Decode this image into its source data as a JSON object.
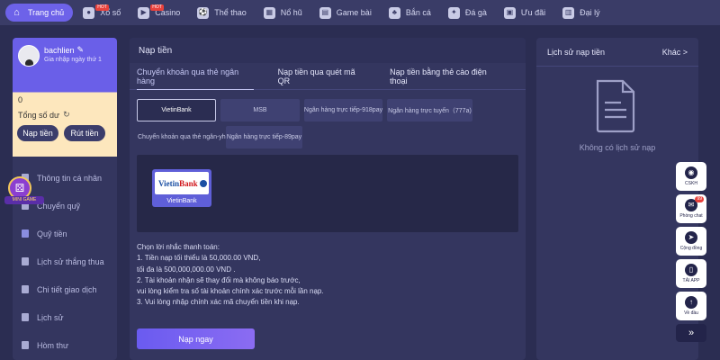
{
  "nav": [
    {
      "label": "Trang chủ",
      "icon": "home-icon",
      "glyph": "⌂",
      "active": true
    },
    {
      "label": "Xổ số",
      "icon": "lottery-icon",
      "glyph": "●",
      "hot": "HOT"
    },
    {
      "label": "Casino",
      "icon": "casino-icon",
      "glyph": "▶",
      "hot": "HOT"
    },
    {
      "label": "Thể thao",
      "icon": "sports-icon",
      "glyph": "⚽"
    },
    {
      "label": "Nổ hũ",
      "icon": "slots-icon",
      "glyph": "▦"
    },
    {
      "label": "Game bài",
      "icon": "card-game-icon",
      "glyph": "▤"
    },
    {
      "label": "Bắn cá",
      "icon": "fish-icon",
      "glyph": "♣"
    },
    {
      "label": "Đá gà",
      "icon": "cockfight-icon",
      "glyph": "✦"
    },
    {
      "label": "Ưu đãi",
      "icon": "promo-icon",
      "glyph": "▣"
    },
    {
      "label": "Đại lý",
      "icon": "agent-icon",
      "glyph": "▥"
    }
  ],
  "profile": {
    "username": "bachlien",
    "level": "Gia nhập ngày thứ 1",
    "balance": "0",
    "balance_label": "Tổng số dư",
    "deposit_label": "Nạp tiền",
    "withdraw_label": "Rút tiền"
  },
  "menu": [
    {
      "label": "Thông tin cá nhân",
      "name": "menu-item-profile"
    },
    {
      "label": "Chuyển quỹ",
      "name": "menu-item-transfer"
    },
    {
      "label": "Quỹ tiền",
      "name": "menu-item-fund"
    },
    {
      "label": "Lịch sử thắng thua",
      "name": "menu-item-win-loss"
    },
    {
      "label": "Chi tiết giao dịch",
      "name": "menu-item-transactions"
    },
    {
      "label": "Lịch sử",
      "name": "menu-item-history"
    },
    {
      "label": "Hòm thư",
      "name": "menu-item-inbox"
    }
  ],
  "game_badge_label": "MINI GAME",
  "deposit": {
    "title": "Nạp tiền",
    "tabs": [
      "Chuyển khoản qua thẻ ngân hàng",
      "Nạp tiền qua quét mã QR",
      "Nạp tiền bằng thẻ cào điện thoại"
    ],
    "banks_row1": [
      "VietinBank",
      "MSB",
      "Ngân hàng trực tiếp-918pay",
      "Ngân hàng trực tuyến（777a)"
    ],
    "banks_row2": [
      "Chuyển khoản qua thẻ ngân-yh",
      "Ngân hàng trực tiếp-89pay"
    ],
    "selected_bank": {
      "logo_left": "Vietin",
      "logo_right": "Bank",
      "name": "VietinBank"
    },
    "notes": [
      "Chọn lời nhắc thanh toán:",
      "1. Tiền nạp tối thiểu là 50,000.00 VND,",
      "tối đa là 500,000,000.00 VND .",
      "2. Tài khoản nhận sẽ thay đổi mà không báo trước,",
      "vui lòng kiểm tra số tài khoản chính xác trước mỗi lần nạp.",
      "3. Vui lòng nhập chính xác mã chuyển tiền khi nạp."
    ],
    "submit_label": "Nạp ngay"
  },
  "history": {
    "title": "Lịch sử nạp tiền",
    "more": "Khác >",
    "empty": "Không có lịch sử nạp"
  },
  "float_tools": [
    {
      "label": "CSKH",
      "name": "support-button",
      "icon": "headset-icon",
      "glyph": "◉"
    },
    {
      "label": "Phòng chat",
      "name": "chat-button",
      "icon": "chat-icon",
      "glyph": "✉",
      "badge": "99"
    },
    {
      "label": "Cộng đồng",
      "name": "community-button",
      "icon": "send-icon",
      "glyph": "➤"
    },
    {
      "label": "TẢI APP",
      "name": "download-app-button",
      "icon": "phone-icon",
      "glyph": "▯"
    },
    {
      "label": "Về đầu",
      "name": "back-to-top-button",
      "icon": "arrow-up-icon",
      "glyph": "↑"
    }
  ],
  "collapse_glyph": "»"
}
